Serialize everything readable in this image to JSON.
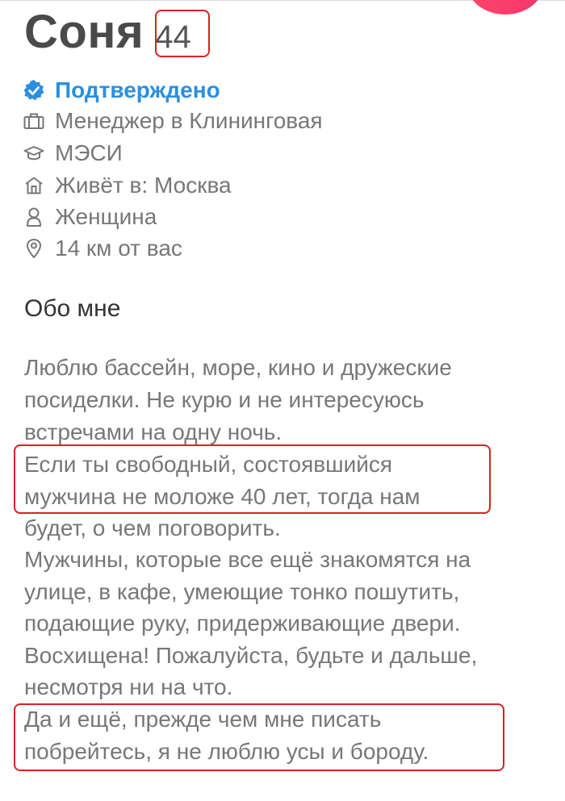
{
  "profile": {
    "name": "Соня",
    "age": "44"
  },
  "info": {
    "verified": "Подтверждено",
    "job": "Менеджер в Клининговая",
    "education": "МЭСИ",
    "lives": "Живёт в: Москва",
    "gender": "Женщина",
    "distance": "14 км от вас"
  },
  "about": {
    "title": "Обо мне",
    "lines": [
      "Люблю бассейн, море, кино и дружеские",
      "посиделки. Не курю и не интересуюсь",
      "встречами на одну ночь.",
      "Если ты свободный, состоявшийся",
      "мужчина не моложе 40 лет, тогда нам",
      "будет, о чем поговорить.",
      "Мужчины, которые все ещё знакомятся на",
      "улице, в кафе, умеющие тонко пошутить,",
      "подающие руку, придерживающие двери.",
      "Восхищена! Пожалуйста, будьте и дальше,",
      "несмотря ни на что.",
      "Да и ещё, прежде чем мне писать",
      "побрейтесь, я не люблю усы и бороду."
    ]
  },
  "colors": {
    "accent": "#2a8fe0",
    "highlight": "#d62323",
    "fab": "#f5356b"
  },
  "icons": [
    "verified-badge-icon",
    "briefcase-icon",
    "graduation-cap-icon",
    "home-icon",
    "person-icon",
    "location-pin-icon"
  ]
}
